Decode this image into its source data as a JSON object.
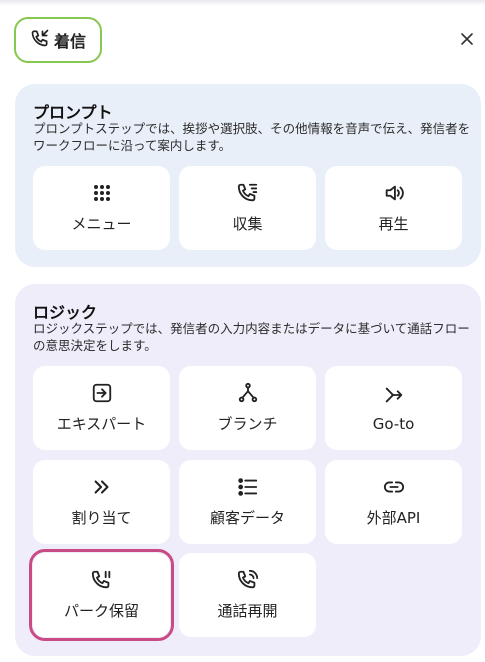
{
  "header": {
    "chip_label": "着信",
    "chip_icon": "phone-incoming-icon",
    "close_icon": "close-icon",
    "chip_border_color": "#86c84f"
  },
  "prompt": {
    "title": "プロンプト",
    "description": "プロンプトステップでは、挨拶や選択肢、その他情報を音声で伝え、発信者をワークフローに沿って案内します。",
    "items": [
      {
        "label": "メニュー",
        "icon": "dial-grid-icon"
      },
      {
        "label": "収集",
        "icon": "phone-collect-icon"
      },
      {
        "label": "再生",
        "icon": "speaker-play-icon"
      }
    ]
  },
  "logic": {
    "title": "ロジック",
    "description": "ロジックステップでは、発信者の入力内容またはデータに基づいて通話フローの意思決定をします。",
    "items": [
      {
        "label": "エキスパート",
        "icon": "transfer-in-icon"
      },
      {
        "label": "ブランチ",
        "icon": "branch-icon"
      },
      {
        "label": "Go-to",
        "icon": "goto-arrow-icon"
      },
      {
        "label": "割り当て",
        "icon": "double-chevron-icon"
      },
      {
        "label": "顧客データ",
        "icon": "list-icon"
      },
      {
        "label": "外部API",
        "icon": "link-icon"
      },
      {
        "label": "パーク保留",
        "icon": "phone-hold-icon"
      },
      {
        "label": "通話再開",
        "icon": "phone-resume-icon"
      }
    ],
    "highlight_color": "#c94b86"
  }
}
